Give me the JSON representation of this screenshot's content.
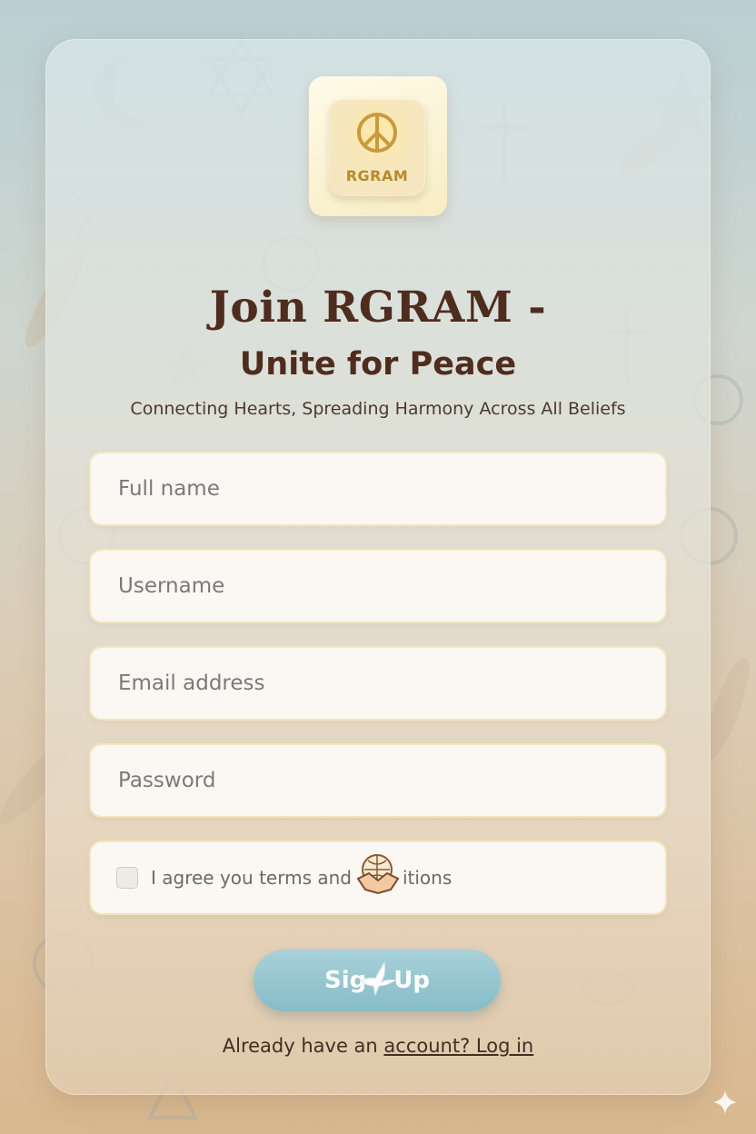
{
  "brand": {
    "logo_text": "RGRAM"
  },
  "header": {
    "title": "Join RGRAM -",
    "subtitle": "Unite for Peace",
    "tagline": "Connecting Hearts, Spreading Harmony Across All Beliefs"
  },
  "form": {
    "full_name_placeholder": "Full name",
    "username_placeholder": "Username",
    "email_placeholder": "Email address",
    "password_placeholder": "Password",
    "terms_label": "I agree you terms and",
    "terms_suffix": "itions",
    "terms_checked": false,
    "submit_label_a": "Sig",
    "submit_label_b": "Up"
  },
  "footer": {
    "prompt": "Already have an",
    "link_label": "account? Log in"
  },
  "colors": {
    "title": "#4e2c1e",
    "button": "#8fc3cd",
    "logo_accent": "#b88a2c"
  },
  "icons": [
    "peace-sign-icon",
    "handshake-globe-icon",
    "dove-icon",
    "sparkle-icon"
  ]
}
